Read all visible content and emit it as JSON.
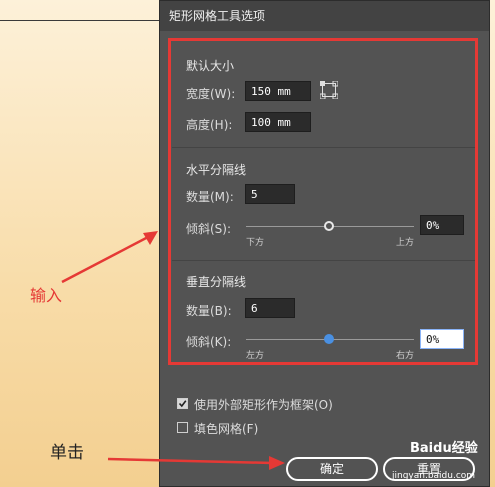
{
  "dialog": {
    "title": "矩形网格工具选项"
  },
  "default_size": {
    "title": "默认大小",
    "width_label": "宽度(W):",
    "width_value": "150 mm",
    "height_label": "高度(H):",
    "height_value": "100 mm"
  },
  "horizontal_dividers": {
    "title": "水平分隔线",
    "count_label": "数量(M):",
    "count_value": "5",
    "skew_label": "倾斜(S):",
    "skew_value": "0%",
    "left_tick": "下方",
    "right_tick": "上方"
  },
  "vertical_dividers": {
    "title": "垂直分隔线",
    "count_label": "数量(B):",
    "count_value": "6",
    "skew_label": "倾斜(K):",
    "skew_value": "0%",
    "left_tick": "左方",
    "right_tick": "右方"
  },
  "options": {
    "use_outer_rect": {
      "label": "使用外部矩形作为框架(O)",
      "checked": true
    },
    "fill_grid": {
      "label": "填色网格(F)",
      "checked": false
    }
  },
  "buttons": {
    "ok": "确定",
    "reset": "重置"
  },
  "annotations": {
    "input": "输入",
    "click": "单击"
  },
  "watermark": {
    "brand": "Baidu经验",
    "url": "jingyan.baidu.com"
  },
  "colors": {
    "accent": "#e53935",
    "slider_active": "#4a90e2",
    "dialog_bg": "#535353"
  }
}
